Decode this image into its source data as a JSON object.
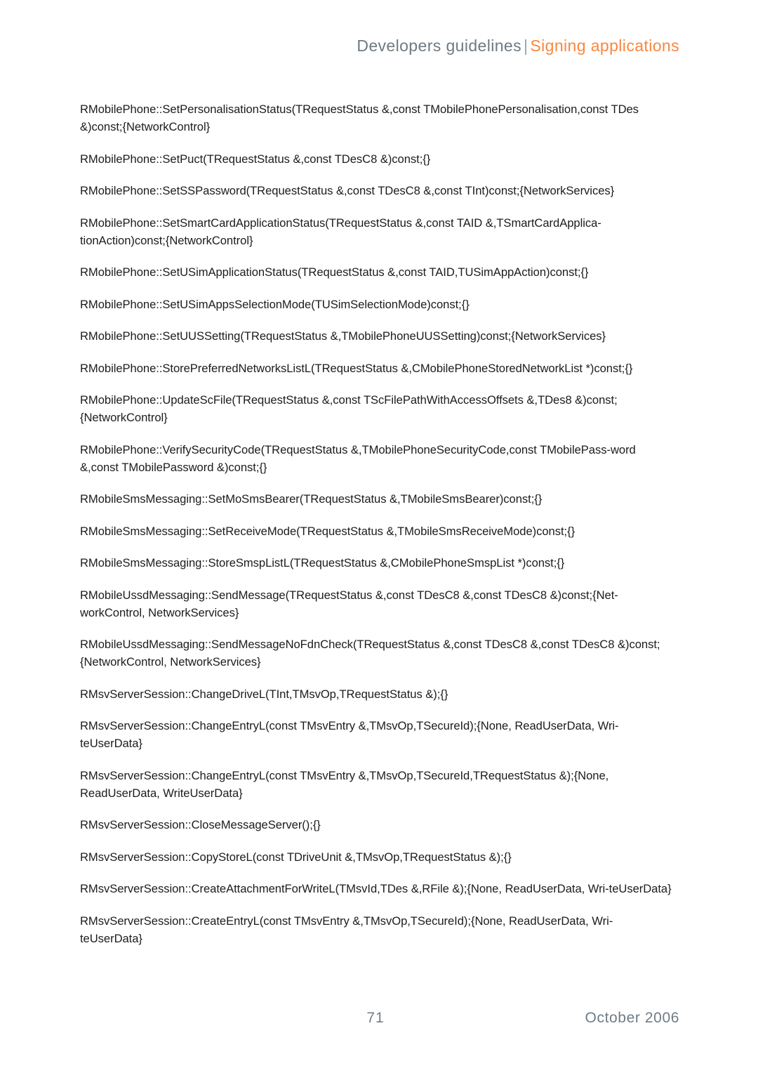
{
  "header": {
    "main_title": "Developers guidelines",
    "separator": "|",
    "section_title": "Signing applications",
    "main_color": "#6e7a82",
    "accent_color": "#f9873f"
  },
  "footer": {
    "page_number": "71",
    "date": "October 2006",
    "text_color": "#6f7b85"
  },
  "main": {
    "entries": [
      "RMobilePhone::SetPersonalisationStatus(TRequestStatus &,const TMobilePhonePersonalisation,const TDes &)const;{NetworkControl}",
      "RMobilePhone::SetPuct(TRequestStatus &,const TDesC8 &)const;{}",
      "RMobilePhone::SetSSPassword(TRequestStatus &,const TDesC8 &,const TInt)const;{NetworkServices}",
      "RMobilePhone::SetSmartCardApplicationStatus(TRequestStatus &,const TAID &,TSmartCardApplica-tionAction)const;{NetworkControl}",
      "RMobilePhone::SetUSimApplicationStatus(TRequestStatus &,const TAID,TUSimAppAction)const;{}",
      "RMobilePhone::SetUSimAppsSelectionMode(TUSimSelectionMode)const;{}",
      "RMobilePhone::SetUUSSetting(TRequestStatus &,TMobilePhoneUUSSetting)const;{NetworkServices}",
      "RMobilePhone::StorePreferredNetworksListL(TRequestStatus &,CMobilePhoneStoredNetworkList *)const;{}",
      "RMobilePhone::UpdateScFile(TRequestStatus &,const TScFilePathWithAccessOffsets &,TDes8 &)const;{NetworkControl}",
      "RMobilePhone::VerifySecurityCode(TRequestStatus &,TMobilePhoneSecurityCode,const TMobilePass-word &,const TMobilePassword &)const;{}",
      "RMobileSmsMessaging::SetMoSmsBearer(TRequestStatus &,TMobileSmsBearer)const;{}",
      "RMobileSmsMessaging::SetReceiveMode(TRequestStatus &,TMobileSmsReceiveMode)const;{}",
      "RMobileSmsMessaging::StoreSmspListL(TRequestStatus &,CMobilePhoneSmspList *)const;{}",
      "RMobileUssdMessaging::SendMessage(TRequestStatus &,const TDesC8 &,const TDesC8 &)const;{Net-workControl, NetworkServices}",
      "RMobileUssdMessaging::SendMessageNoFdnCheck(TRequestStatus &,const TDesC8 &,const TDesC8 &)const;{NetworkControl, NetworkServices}",
      "RMsvServerSession::ChangeDriveL(TInt,TMsvOp,TRequestStatus &);{}",
      "RMsvServerSession::ChangeEntryL(const TMsvEntry &,TMsvOp,TSecureId);{None, ReadUserData, Wri-teUserData}",
      "RMsvServerSession::ChangeEntryL(const TMsvEntry &,TMsvOp,TSecureId,TRequestStatus &);{None, ReadUserData, WriteUserData}",
      "RMsvServerSession::CloseMessageServer();{}",
      "RMsvServerSession::CopyStoreL(const TDriveUnit &,TMsvOp,TRequestStatus &);{}",
      "RMsvServerSession::CreateAttachmentForWriteL(TMsvId,TDes &,RFile &);{None, ReadUserData, Wri-teUserData}",
      "RMsvServerSession::CreateEntryL(const TMsvEntry &,TMsvOp,TSecureId);{None, ReadUserData, Wri-teUserData}"
    ]
  }
}
